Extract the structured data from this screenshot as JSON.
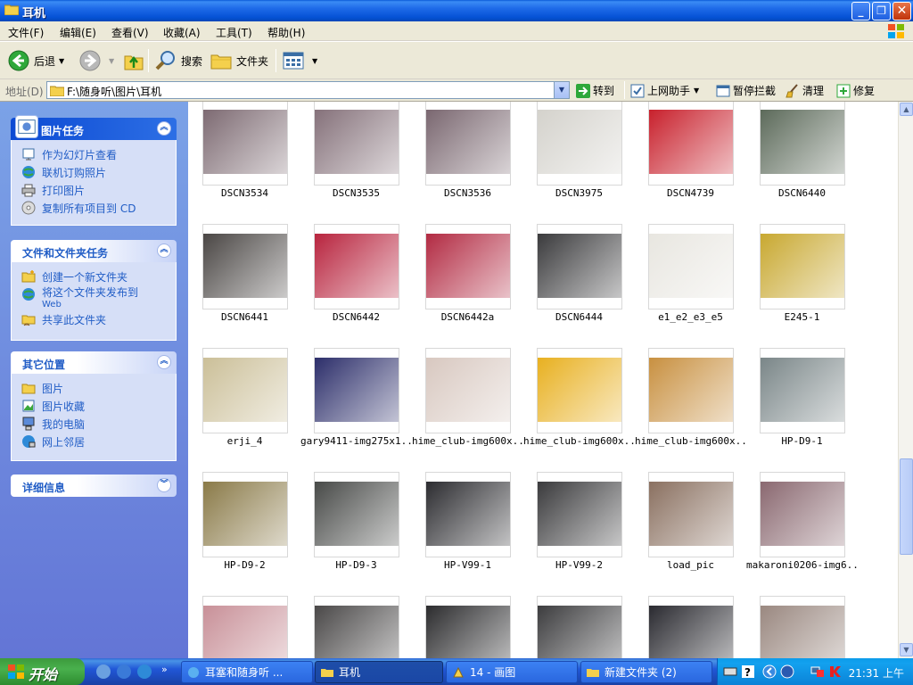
{
  "window": {
    "title": "耳机",
    "buttons": {
      "minimize": "_",
      "maximize": "❐",
      "close": "✕"
    }
  },
  "menu": [
    "文件(F)",
    "编辑(E)",
    "查看(V)",
    "收藏(A)",
    "工具(T)",
    "帮助(H)"
  ],
  "toolbar": {
    "back": "后退",
    "search": "搜索",
    "folders": "文件夹"
  },
  "address": {
    "label": "地址(D)",
    "path": "F:\\随身听\\图片\\耳机",
    "go": "转到",
    "extras": [
      "上网助手",
      "暂停拦截",
      "清理",
      "修复"
    ]
  },
  "taskpane": {
    "picture_tasks": {
      "title": "图片任务",
      "items": [
        "作为幻灯片查看",
        "联机订购照片",
        "打印图片",
        "复制所有项目到 CD"
      ]
    },
    "file_tasks": {
      "title": "文件和文件夹任务",
      "items": [
        "创建一个新文件夹",
        "将这个文件夹发布到",
        "Web",
        "共享此文件夹"
      ]
    },
    "other_places": {
      "title": "其它位置",
      "items": [
        "图片",
        "图片收藏",
        "我的电脑",
        "网上邻居"
      ]
    },
    "details": {
      "title": "详细信息"
    }
  },
  "files": [
    {
      "name": "DSCN3534",
      "color": "#7d6a72"
    },
    {
      "name": "DSCN3535",
      "color": "#85717a"
    },
    {
      "name": "DSCN3536",
      "color": "#7a6770"
    },
    {
      "name": "DSCN3975",
      "color": "#d4d2cc"
    },
    {
      "name": "DSCN4739",
      "color": "#c8202c"
    },
    {
      "name": "DSCN6440",
      "color": "#5c6a5a"
    },
    {
      "name": "DSCN6441",
      "color": "#4a4644"
    },
    {
      "name": "DSCN6442",
      "color": "#b8243e"
    },
    {
      "name": "DSCN6442a",
      "color": "#b22a42"
    },
    {
      "name": "DSCN6444",
      "color": "#3a3a3c"
    },
    {
      "name": "e1_e2_e3_e5",
      "color": "#e8e6e0"
    },
    {
      "name": "E245-1",
      "color": "#c8a830"
    },
    {
      "name": "erji_4",
      "color": "#cbbf98"
    },
    {
      "name": "gary9411-img275x1...",
      "color": "#2c2e6a"
    },
    {
      "name": "hime_club-img600x...",
      "color": "#d8c8c0"
    },
    {
      "name": "hime_club-img600x...",
      "color": "#e8b020"
    },
    {
      "name": "hime_club-img600x...",
      "color": "#c89040"
    },
    {
      "name": "HP-D9-1",
      "color": "#7a8688"
    },
    {
      "name": "HP-D9-2",
      "color": "#8a7a48"
    },
    {
      "name": "HP-D9-3",
      "color": "#484a48"
    },
    {
      "name": "HP-V99-1",
      "color": "#2c2c30"
    },
    {
      "name": "HP-V99-2",
      "color": "#3a3a3c"
    },
    {
      "name": "load_pic",
      "color": "#8a7060"
    },
    {
      "name": "makaroni0206-img6...",
      "color": "#8a6870"
    },
    {
      "name": "",
      "color": "#c89098"
    },
    {
      "name": "",
      "color": "#4a4848"
    },
    {
      "name": "",
      "color": "#2c2c2e"
    },
    {
      "name": "",
      "color": "#3c3c3e"
    },
    {
      "name": "",
      "color": "#2a2a30"
    },
    {
      "name": "",
      "color": "#9a8880"
    }
  ],
  "taskbar": {
    "start": "开始",
    "tasks": [
      "耳塞和随身听 ...",
      "耳机",
      "14 - 画图",
      "新建文件夹 (2)"
    ],
    "clock": "21:31 上午"
  },
  "colors": {
    "accent": "#0552d6",
    "taskpane_link": "#215dc6",
    "taskbar": "#2157d7",
    "start_green": "#3c9a3c"
  }
}
